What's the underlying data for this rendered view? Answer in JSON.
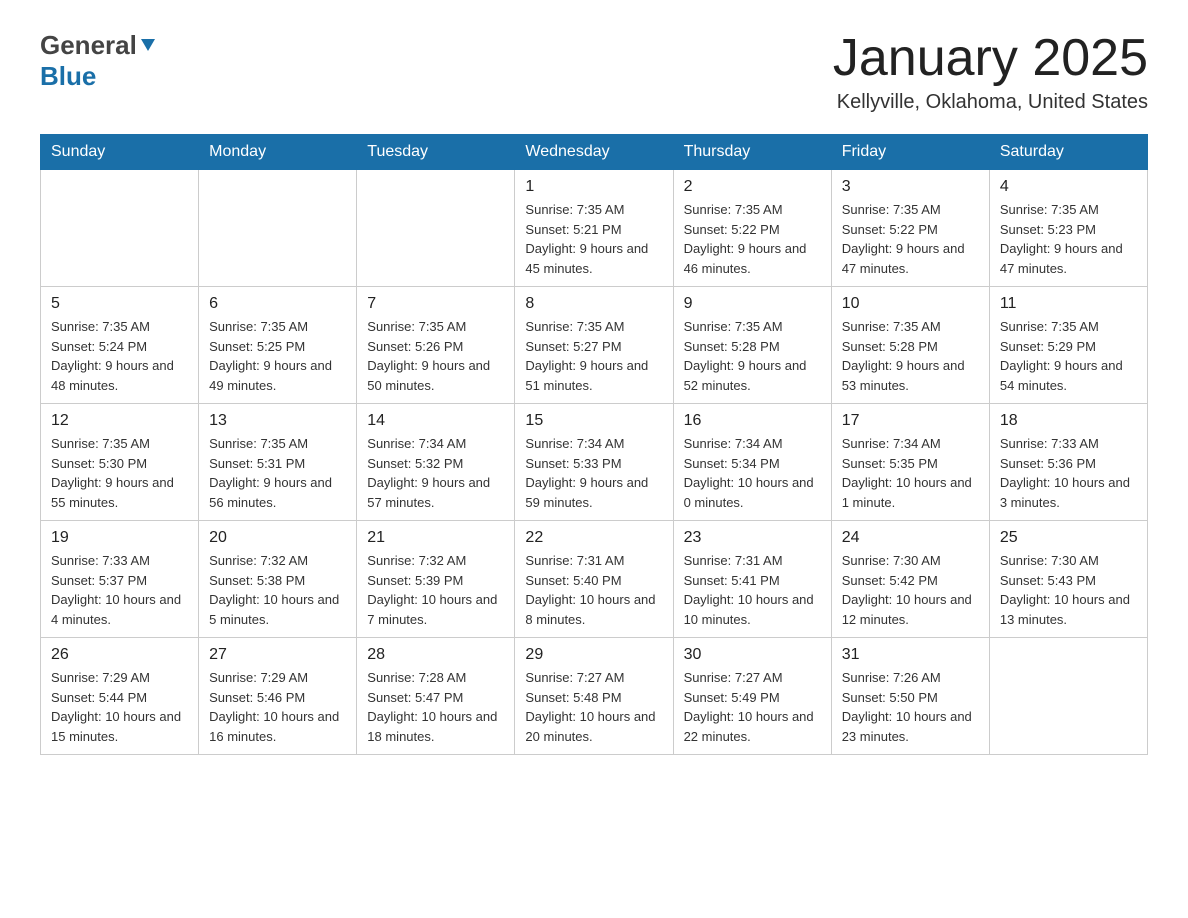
{
  "header": {
    "logo_general": "General",
    "logo_blue": "Blue",
    "month_title": "January 2025",
    "location": "Kellyville, Oklahoma, United States"
  },
  "days_of_week": [
    "Sunday",
    "Monday",
    "Tuesday",
    "Wednesday",
    "Thursday",
    "Friday",
    "Saturday"
  ],
  "weeks": [
    [
      {
        "day": "",
        "info": ""
      },
      {
        "day": "",
        "info": ""
      },
      {
        "day": "",
        "info": ""
      },
      {
        "day": "1",
        "info": "Sunrise: 7:35 AM\nSunset: 5:21 PM\nDaylight: 9 hours\nand 45 minutes."
      },
      {
        "day": "2",
        "info": "Sunrise: 7:35 AM\nSunset: 5:22 PM\nDaylight: 9 hours\nand 46 minutes."
      },
      {
        "day": "3",
        "info": "Sunrise: 7:35 AM\nSunset: 5:22 PM\nDaylight: 9 hours\nand 47 minutes."
      },
      {
        "day": "4",
        "info": "Sunrise: 7:35 AM\nSunset: 5:23 PM\nDaylight: 9 hours\nand 47 minutes."
      }
    ],
    [
      {
        "day": "5",
        "info": "Sunrise: 7:35 AM\nSunset: 5:24 PM\nDaylight: 9 hours\nand 48 minutes."
      },
      {
        "day": "6",
        "info": "Sunrise: 7:35 AM\nSunset: 5:25 PM\nDaylight: 9 hours\nand 49 minutes."
      },
      {
        "day": "7",
        "info": "Sunrise: 7:35 AM\nSunset: 5:26 PM\nDaylight: 9 hours\nand 50 minutes."
      },
      {
        "day": "8",
        "info": "Sunrise: 7:35 AM\nSunset: 5:27 PM\nDaylight: 9 hours\nand 51 minutes."
      },
      {
        "day": "9",
        "info": "Sunrise: 7:35 AM\nSunset: 5:28 PM\nDaylight: 9 hours\nand 52 minutes."
      },
      {
        "day": "10",
        "info": "Sunrise: 7:35 AM\nSunset: 5:28 PM\nDaylight: 9 hours\nand 53 minutes."
      },
      {
        "day": "11",
        "info": "Sunrise: 7:35 AM\nSunset: 5:29 PM\nDaylight: 9 hours\nand 54 minutes."
      }
    ],
    [
      {
        "day": "12",
        "info": "Sunrise: 7:35 AM\nSunset: 5:30 PM\nDaylight: 9 hours\nand 55 minutes."
      },
      {
        "day": "13",
        "info": "Sunrise: 7:35 AM\nSunset: 5:31 PM\nDaylight: 9 hours\nand 56 minutes."
      },
      {
        "day": "14",
        "info": "Sunrise: 7:34 AM\nSunset: 5:32 PM\nDaylight: 9 hours\nand 57 minutes."
      },
      {
        "day": "15",
        "info": "Sunrise: 7:34 AM\nSunset: 5:33 PM\nDaylight: 9 hours\nand 59 minutes."
      },
      {
        "day": "16",
        "info": "Sunrise: 7:34 AM\nSunset: 5:34 PM\nDaylight: 10 hours\nand 0 minutes."
      },
      {
        "day": "17",
        "info": "Sunrise: 7:34 AM\nSunset: 5:35 PM\nDaylight: 10 hours\nand 1 minute."
      },
      {
        "day": "18",
        "info": "Sunrise: 7:33 AM\nSunset: 5:36 PM\nDaylight: 10 hours\nand 3 minutes."
      }
    ],
    [
      {
        "day": "19",
        "info": "Sunrise: 7:33 AM\nSunset: 5:37 PM\nDaylight: 10 hours\nand 4 minutes."
      },
      {
        "day": "20",
        "info": "Sunrise: 7:32 AM\nSunset: 5:38 PM\nDaylight: 10 hours\nand 5 minutes."
      },
      {
        "day": "21",
        "info": "Sunrise: 7:32 AM\nSunset: 5:39 PM\nDaylight: 10 hours\nand 7 minutes."
      },
      {
        "day": "22",
        "info": "Sunrise: 7:31 AM\nSunset: 5:40 PM\nDaylight: 10 hours\nand 8 minutes."
      },
      {
        "day": "23",
        "info": "Sunrise: 7:31 AM\nSunset: 5:41 PM\nDaylight: 10 hours\nand 10 minutes."
      },
      {
        "day": "24",
        "info": "Sunrise: 7:30 AM\nSunset: 5:42 PM\nDaylight: 10 hours\nand 12 minutes."
      },
      {
        "day": "25",
        "info": "Sunrise: 7:30 AM\nSunset: 5:43 PM\nDaylight: 10 hours\nand 13 minutes."
      }
    ],
    [
      {
        "day": "26",
        "info": "Sunrise: 7:29 AM\nSunset: 5:44 PM\nDaylight: 10 hours\nand 15 minutes."
      },
      {
        "day": "27",
        "info": "Sunrise: 7:29 AM\nSunset: 5:46 PM\nDaylight: 10 hours\nand 16 minutes."
      },
      {
        "day": "28",
        "info": "Sunrise: 7:28 AM\nSunset: 5:47 PM\nDaylight: 10 hours\nand 18 minutes."
      },
      {
        "day": "29",
        "info": "Sunrise: 7:27 AM\nSunset: 5:48 PM\nDaylight: 10 hours\nand 20 minutes."
      },
      {
        "day": "30",
        "info": "Sunrise: 7:27 AM\nSunset: 5:49 PM\nDaylight: 10 hours\nand 22 minutes."
      },
      {
        "day": "31",
        "info": "Sunrise: 7:26 AM\nSunset: 5:50 PM\nDaylight: 10 hours\nand 23 minutes."
      },
      {
        "day": "",
        "info": ""
      }
    ]
  ]
}
